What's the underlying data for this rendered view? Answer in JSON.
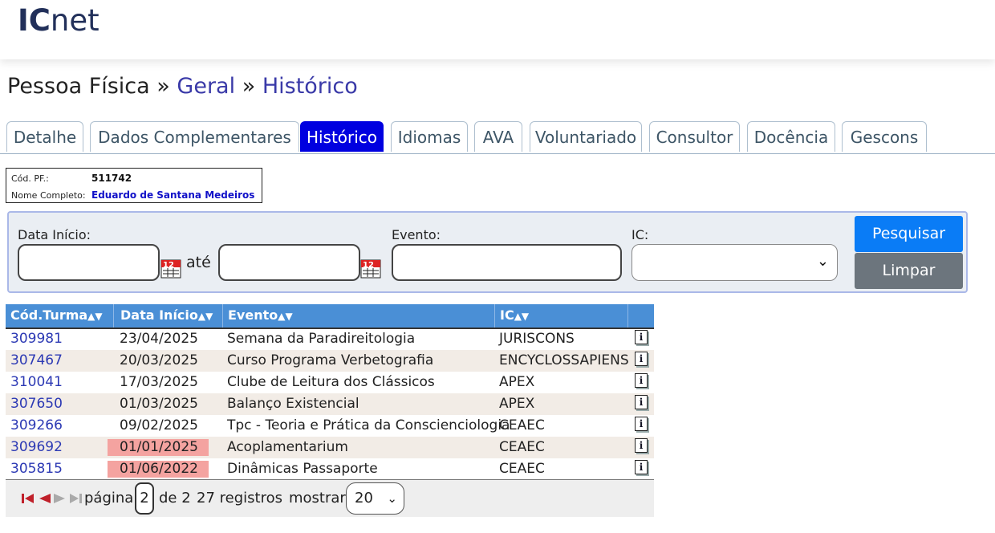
{
  "header": {
    "logo_ic": "IC",
    "logo_net": "net"
  },
  "breadcrumb": {
    "root": "Pessoa Física",
    "sep1": "»",
    "geral": "Geral",
    "sep2": "»",
    "current": "Histórico"
  },
  "tabs": [
    {
      "label": "Detalhe"
    },
    {
      "label": "Dados Complementares"
    },
    {
      "label": "Histórico",
      "active": true
    },
    {
      "label": "Idiomas"
    },
    {
      "label": "AVA"
    },
    {
      "label": "Voluntariado"
    },
    {
      "label": "Consultor"
    },
    {
      "label": "Docência"
    },
    {
      "label": "Gescons"
    }
  ],
  "person": {
    "code_label": "Cód. PF.:",
    "code_value": "511742",
    "name_label": "Nome Completo:",
    "name_value": "Eduardo de Santana Medeiros"
  },
  "filter": {
    "date_start_label": "Data Início:",
    "date_start_value": "",
    "ate_label": "até",
    "date_end_value": "",
    "event_label": "Evento:",
    "event_value": "",
    "ic_label": "IC:",
    "ic_value": "",
    "search_button": "Pesquisar",
    "clear_button": "Limpar"
  },
  "table": {
    "columns": [
      "Cód.Turma",
      "Data Início",
      "Evento",
      "IC"
    ],
    "sort_arrows": "▲▼",
    "rows": [
      {
        "code": "309981",
        "date": "23/04/2025",
        "event": "Semana da Paradireitologia",
        "ic": "JURISCONS",
        "highlight": false
      },
      {
        "code": "307467",
        "date": "20/03/2025",
        "event": "Curso Programa Verbetografia",
        "ic": "ENCYCLOSSAPIENS",
        "highlight": false
      },
      {
        "code": "310041",
        "date": "17/03/2025",
        "event": "Clube de Leitura dos Clássicos",
        "ic": "APEX",
        "highlight": false
      },
      {
        "code": "307650",
        "date": "01/03/2025",
        "event": "Balanço Existencial",
        "ic": "APEX",
        "highlight": false
      },
      {
        "code": "309266",
        "date": "09/02/2025",
        "event": "Tpc - Teoria e Prática da Conscienciologia",
        "ic": "CEAEC",
        "highlight": false
      },
      {
        "code": "309692",
        "date": "01/01/2025",
        "event": "Acoplamentarium",
        "ic": "CEAEC",
        "highlight": true
      },
      {
        "code": "305815",
        "date": "01/06/2022",
        "event": "Dinâmicas Passaporte",
        "ic": "CEAEC",
        "highlight": true
      }
    ],
    "row_icon": "info-icon"
  },
  "pager": {
    "page_label": "página",
    "page_value": "2",
    "of_label": "de 2",
    "records_label": "27 registros",
    "show_label": "mostrar",
    "show_value": "20"
  },
  "colors": {
    "accent": "#0000e0",
    "table_header": "#4a8fd6",
    "link": "#2c39b4",
    "highlight": "#f4a3a0",
    "search_button": "#0a7cf6",
    "clear_button": "#6c757d"
  }
}
